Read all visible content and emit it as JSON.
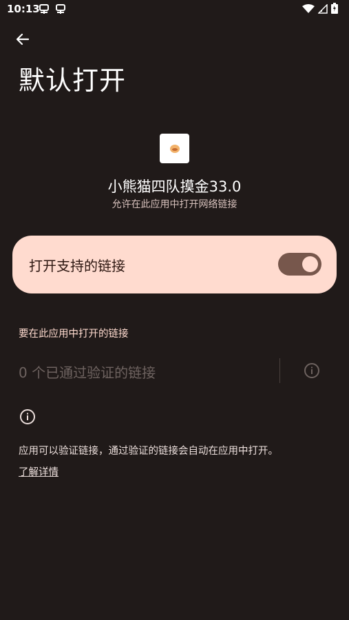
{
  "status": {
    "time": "10:13"
  },
  "header": {
    "title": "默认打开"
  },
  "app": {
    "name": "小熊猫四队摸金33.0",
    "subtitle": "允许在此应用中打开网络链接"
  },
  "toggle": {
    "label": "打开支持的链接",
    "state": "on"
  },
  "links_section": {
    "label": "要在此应用中打开的链接",
    "verified_count_text": "0 个已通过验证的链接"
  },
  "info": {
    "text": "应用可以验证链接，通过验证的链接会自动在应用中打开。",
    "learn_more": "了解详情"
  },
  "colors": {
    "background": "#201a19",
    "card": "#ffdbcf",
    "switch_track": "#77574c"
  }
}
